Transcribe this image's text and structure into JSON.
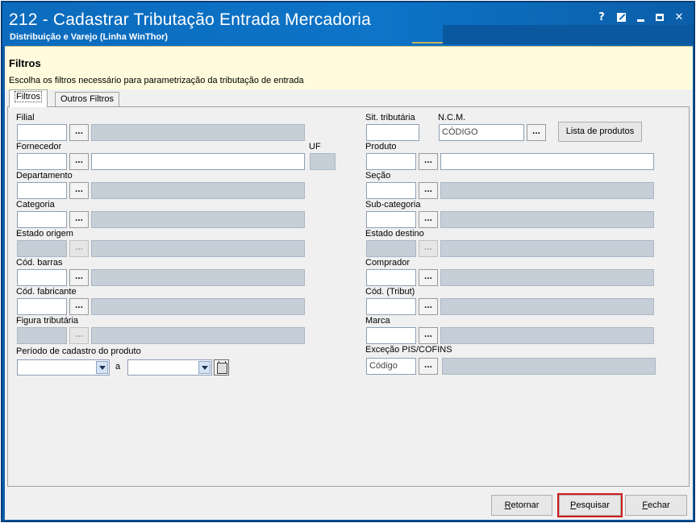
{
  "window": {
    "title": "212 - Cadastrar Tributação Entrada Mercadoria",
    "subtitle": "Distribuição e Varejo (Linha WinThor)",
    "controls": {
      "help": "?",
      "close": "✕"
    }
  },
  "header": {
    "title": "Filtros",
    "description": "Escolha os filtros necessário para parametrização da tributação de entrada"
  },
  "tabs": [
    {
      "label": "Filtros",
      "active": true
    },
    {
      "label": "Outros Filtros",
      "active": false
    }
  ],
  "left_fields": {
    "filial": "Filial",
    "fornecedor": "Fornecedor",
    "uf": "UF",
    "departamento": "Departamento",
    "categoria": "Categoria",
    "estado_origem": "Estado origem",
    "cod_barras": "Cód. barras",
    "cod_fabricante": "Cód. fabricante",
    "figura_tributaria": "Figura tributária",
    "periodo": "Período de cadastro do produto",
    "periodo_sep": "a"
  },
  "right_fields": {
    "sit_tributaria": "Sit. tributária",
    "ncm": "N.C.M.",
    "ncm_placeholder": "CÓDIGO",
    "lista_produtos": "Lista de produtos",
    "produto": "Produto",
    "secao": "Seção",
    "sub_categoria": "Sub-categoria",
    "estado_destino": "Estado destino",
    "comprador": "Comprador",
    "cod_tribut": "Cód. (Tribut)",
    "marca": "Marca",
    "excecao": "Exceção PIS/COFINS",
    "excecao_placeholder": "Código"
  },
  "common": {
    "dots": "..."
  },
  "buttons": {
    "retornar": {
      "first": "R",
      "rest": "etornar"
    },
    "pesquisar": {
      "first": "P",
      "rest": "esquisar"
    },
    "fechar": {
      "first": "F",
      "rest": "echar"
    }
  },
  "colors": {
    "titlebar": "#0c6bbd",
    "filter_box": "#fffbdc",
    "highlight": "#d21c1c",
    "disabled_input": "#c6cfd8"
  }
}
